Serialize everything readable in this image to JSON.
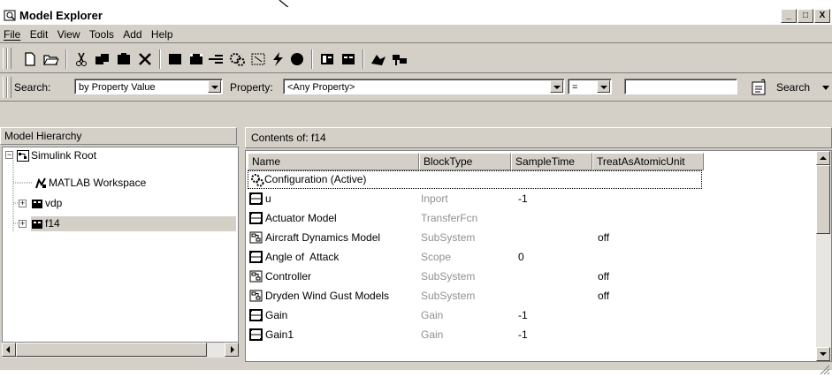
{
  "window": {
    "title": "Model Explorer",
    "controls": [
      "_",
      "□",
      "X"
    ]
  },
  "menu": [
    {
      "label": "File",
      "key": "F"
    },
    {
      "label": "Edit",
      "key": "E"
    },
    {
      "label": "View",
      "key": "V"
    },
    {
      "label": "Tools",
      "key": "T"
    },
    {
      "label": "Add",
      "key": "A"
    },
    {
      "label": "Help",
      "key": "H"
    }
  ],
  "search": {
    "search_label": "Search:",
    "search_type": "by Property Value",
    "property_label": "Property:",
    "property_value": "<Any Property>",
    "operator": "=",
    "value": "",
    "search_button": "Search"
  },
  "hierarchy": {
    "header": "Model Hierarchy",
    "nodes": [
      {
        "label": "Simulink Root",
        "icon": "simulink-root-icon"
      },
      {
        "label": "MATLAB Workspace",
        "icon": "workspace-icon"
      },
      {
        "label": "vdp",
        "icon": "model-icon"
      },
      {
        "label": "f14",
        "icon": "model-icon"
      }
    ]
  },
  "contents": {
    "header": "Contents of:  f14",
    "columns": [
      "Name",
      "BlockType",
      "SampleTime",
      "TreatAsAtomicUnit"
    ],
    "rows": [
      {
        "name": "Configuration (Active)",
        "icon": "configuration-icon",
        "blocktype": "",
        "sampletime": "",
        "atomic": ""
      },
      {
        "name": "u",
        "icon": "block-icon",
        "blocktype": "Inport",
        "sampletime": "-1",
        "atomic": ""
      },
      {
        "name": "Actuator Model",
        "icon": "block-icon",
        "blocktype": "TransferFcn",
        "sampletime": "",
        "atomic": ""
      },
      {
        "name": "Aircraft Dynamics Model",
        "icon": "subsystem-icon",
        "blocktype": "SubSystem",
        "sampletime": "",
        "atomic": "off"
      },
      {
        "name": "Angle of  Attack",
        "icon": "block-icon",
        "blocktype": "Scope",
        "sampletime": "0",
        "atomic": ""
      },
      {
        "name": "Controller",
        "icon": "subsystem-icon",
        "blocktype": "SubSystem",
        "sampletime": "",
        "atomic": "off"
      },
      {
        "name": "Dryden Wind Gust Models",
        "icon": "subsystem-icon",
        "blocktype": "SubSystem",
        "sampletime": "",
        "atomic": "off"
      },
      {
        "name": "Gain",
        "icon": "block-icon",
        "blocktype": "Gain",
        "sampletime": "-1",
        "atomic": ""
      },
      {
        "name": "Gain1",
        "icon": "block-icon",
        "blocktype": "Gain",
        "sampletime": "-1",
        "atomic": ""
      }
    ]
  }
}
